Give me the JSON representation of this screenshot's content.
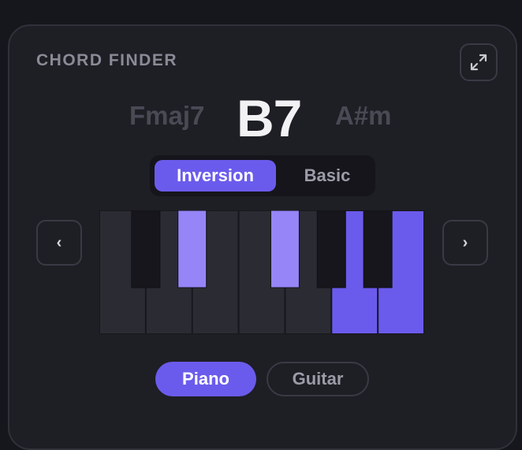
{
  "widget": {
    "title": "CHORD FINDER"
  },
  "chords": {
    "previous": "Fmaj7",
    "current": "B7",
    "next": "A#m"
  },
  "mode_toggle": {
    "options": [
      "Inversion",
      "Basic"
    ],
    "selected": "Inversion"
  },
  "navigation": {
    "prev_glyph": "‹",
    "next_glyph": "›"
  },
  "keyboard": {
    "white_keys": [
      {
        "highlight": "none"
      },
      {
        "highlight": "none"
      },
      {
        "highlight": "none"
      },
      {
        "highlight": "none"
      },
      {
        "highlight": "none"
      },
      {
        "highlight": "strong"
      },
      {
        "highlight": "strong"
      }
    ],
    "black_keys": [
      {
        "after_white": 0,
        "highlight": "none"
      },
      {
        "after_white": 1,
        "highlight": "light"
      },
      {
        "after_white": 3,
        "highlight": "light"
      },
      {
        "after_white": 4,
        "highlight": "none"
      },
      {
        "after_white": 5,
        "highlight": "none"
      }
    ]
  },
  "instrument_toggle": {
    "options": [
      "Piano",
      "Guitar"
    ],
    "selected": "Piano"
  },
  "icons": {
    "expand": "expand-icon",
    "prev": "chevron-left-icon",
    "next": "chevron-right-icon"
  },
  "colors": {
    "accent": "#6b5bec",
    "highlight_light": "#9585f7",
    "card_background": "#1e1e25",
    "page_background": "#16161d",
    "white_key": "#2b2b33",
    "black_key": "#16161c"
  }
}
